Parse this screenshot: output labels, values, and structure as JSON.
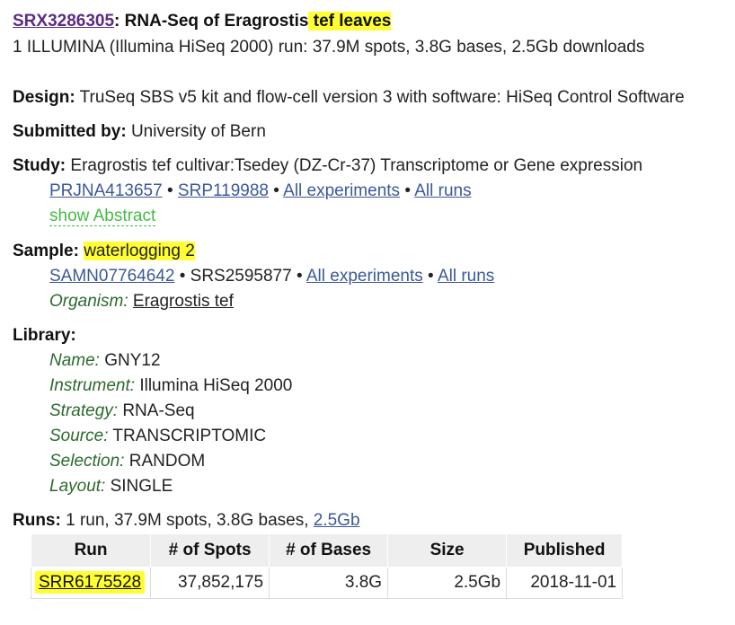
{
  "header": {
    "accession": "SRX3286305",
    "title_main": ": RNA-Seq of Eragrostis",
    "title_highlight": " tef leaves",
    "summary": "1 ILLUMINA (Illumina HiSeq 2000) run: 37.9M spots, 3.8G bases, 2.5Gb downloads"
  },
  "design": {
    "label": "Design:",
    "value": "TruSeq SBS v5 kit and flow-cell version 3 with software: HiSeq Control Software"
  },
  "submitted": {
    "label": "Submitted by:",
    "value": "University of Bern"
  },
  "study": {
    "label": "Study:",
    "value": "Eragrostis tef cultivar:Tsedey (DZ-Cr-37) Transcriptome or Gene expression",
    "bioproject": "PRJNA413657",
    "srp": "SRP119988",
    "all_experiments": "All experiments",
    "all_runs": "All runs",
    "sep": "•",
    "show_abstract": "show Abstract"
  },
  "sample": {
    "label": "Sample:",
    "value": "waterlogging 2",
    "biosample": "SAMN07764642",
    "srs": "SRS2595877",
    "all_experiments": "All experiments",
    "all_runs": "All runs",
    "sep": "•",
    "organism_label": "Organism:",
    "organism": "Eragrostis tef"
  },
  "library": {
    "label": "Library:",
    "fields": [
      {
        "label": "Name:",
        "value": "GNY12"
      },
      {
        "label": "Instrument:",
        "value": "Illumina HiSeq 2000"
      },
      {
        "label": "Strategy:",
        "value": "RNA-Seq"
      },
      {
        "label": "Source:",
        "value": "TRANSCRIPTOMIC"
      },
      {
        "label": "Selection:",
        "value": "RANDOM"
      },
      {
        "label": "Layout:",
        "value": "SINGLE"
      }
    ]
  },
  "runs": {
    "label": "Runs:",
    "summary": "1 run, 37.9M spots, 3.8G bases,",
    "download": "2.5Gb",
    "columns": [
      "Run",
      "# of Spots",
      "# of Bases",
      "Size",
      "Published"
    ],
    "rows": [
      {
        "run": "SRR6175528",
        "spots": "37,852,175",
        "bases": "3.8G",
        "size": "2.5Gb",
        "published": "2018-11-01"
      }
    ]
  },
  "colors": {
    "highlight": "#ffff33",
    "link": "#3b5998",
    "visited_link": "#5b2b86",
    "italic_label": "#2b6a2b",
    "abstract": "#44bb44"
  }
}
